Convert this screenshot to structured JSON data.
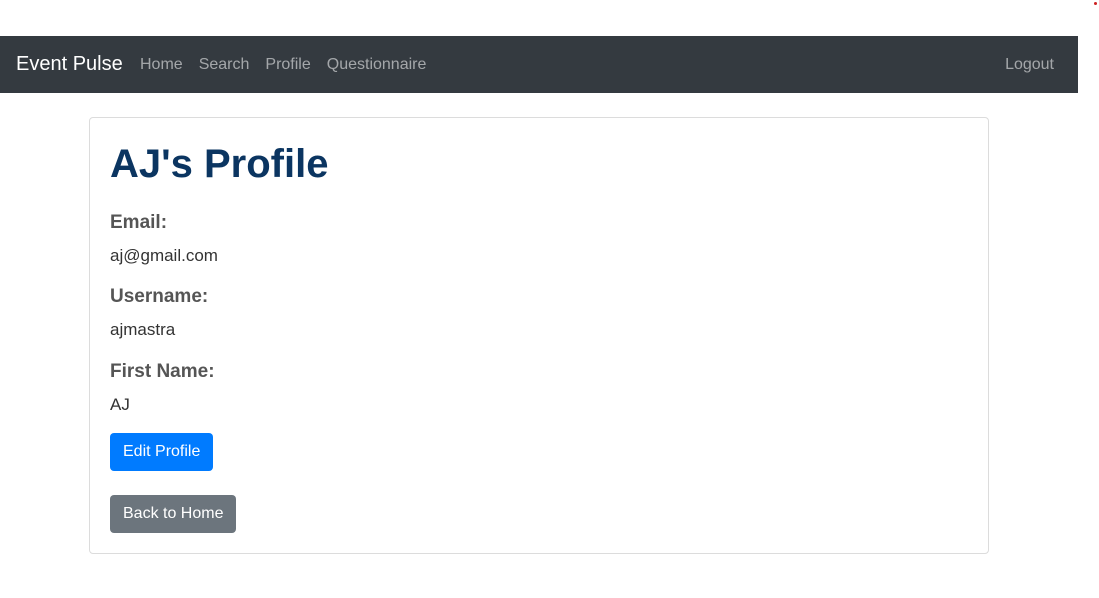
{
  "navbar": {
    "brand": "Event Pulse",
    "links": [
      "Home",
      "Search",
      "Profile",
      "Questionnaire"
    ],
    "logout": "Logout"
  },
  "profile": {
    "title": "AJ's Profile",
    "fields": [
      {
        "label": "Email:",
        "value": "aj@gmail.com"
      },
      {
        "label": "Username:",
        "value": "ajmastra"
      },
      {
        "label": "First Name:",
        "value": "AJ"
      }
    ],
    "edit_button": "Edit Profile",
    "back_button": "Back to Home"
  },
  "colors": {
    "navbar_bg": "#343a40",
    "title": "#0b3561",
    "primary": "#007bff",
    "secondary": "#6c757d"
  }
}
